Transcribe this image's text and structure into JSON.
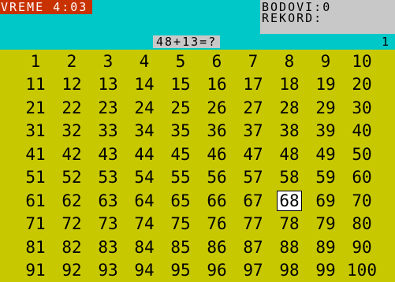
{
  "header": {
    "timer_label": "VREME 4:03",
    "score_label": "BODOVI:0",
    "record_label": "REKORD:"
  },
  "task": {
    "question": "48+13=?",
    "round": "1"
  },
  "board": {
    "numbers": [
      "1",
      "2",
      "3",
      "4",
      "5",
      "6",
      "7",
      "8",
      "9",
      "10",
      "11",
      "12",
      "13",
      "14",
      "15",
      "16",
      "17",
      "18",
      "19",
      "20",
      "21",
      "22",
      "23",
      "24",
      "25",
      "26",
      "27",
      "28",
      "29",
      "30",
      "31",
      "32",
      "33",
      "34",
      "35",
      "36",
      "37",
      "38",
      "39",
      "40",
      "41",
      "42",
      "43",
      "44",
      "45",
      "46",
      "47",
      "48",
      "49",
      "50",
      "51",
      "52",
      "53",
      "54",
      "55",
      "56",
      "57",
      "58",
      "59",
      "60",
      "61",
      "62",
      "63",
      "64",
      "65",
      "66",
      "67",
      "68",
      "69",
      "70",
      "71",
      "72",
      "73",
      "74",
      "75",
      "76",
      "77",
      "78",
      "79",
      "80",
      "81",
      "82",
      "83",
      "84",
      "85",
      "86",
      "87",
      "88",
      "89",
      "90",
      "91",
      "92",
      "93",
      "94",
      "95",
      "96",
      "97",
      "98",
      "99",
      "100"
    ],
    "selected": "68"
  },
  "colors": {
    "board_background": "#c8c800",
    "header_background": "#00c8c8",
    "timer_background": "#c83200",
    "panel_background": "#c8c8c8",
    "selection_background": "#ffffff"
  }
}
